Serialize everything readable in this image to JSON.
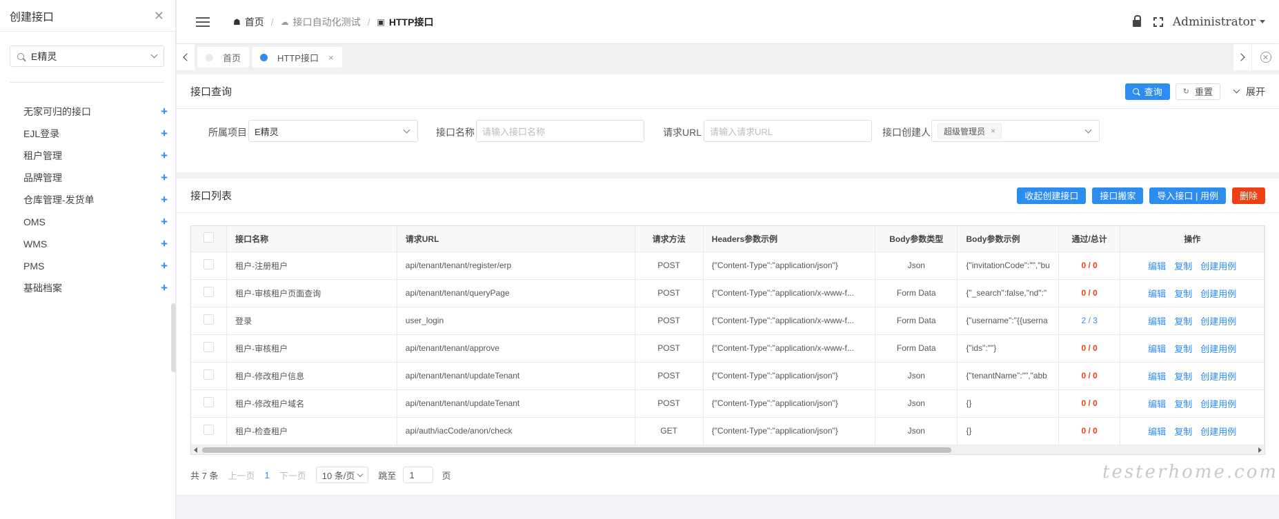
{
  "drawer": {
    "title": "创建接口",
    "close_glyph": "✕",
    "project_value": "E精灵",
    "items": [
      {
        "label": "无家可归的接口"
      },
      {
        "label": "EJL登录"
      },
      {
        "label": "租户管理"
      },
      {
        "label": "品牌管理"
      },
      {
        "label": "仓库管理-发货单"
      },
      {
        "label": "OMS"
      },
      {
        "label": "WMS"
      },
      {
        "label": "PMS"
      },
      {
        "label": "基础档案"
      }
    ],
    "plus_glyph": "+"
  },
  "header": {
    "breadcrumb": [
      "首页",
      "接口自动化测试",
      "HTTP接口"
    ],
    "user": "Administrator"
  },
  "tabs": [
    {
      "label": "首页"
    },
    {
      "label": "HTTP接口",
      "close": "×"
    }
  ],
  "query": {
    "title": "接口查询",
    "search_btn": "查询",
    "reset_btn": "重置",
    "expand": "展开",
    "project_label": "所属项目",
    "project_value": "E精灵",
    "name_label": "接口名称",
    "name_placeholder": "请输入接口名称",
    "url_label": "请求URL",
    "url_placeholder": "请输入请求URL",
    "creator_label": "接口创建人",
    "creator_tag": "超级管理员",
    "tag_close": "×"
  },
  "list": {
    "title": "接口列表",
    "buttons": {
      "collapse_create": "收起创建接口",
      "move": "接口搬家",
      "import": "导入接口 | 用例",
      "delete": "删除"
    },
    "columns": [
      "接口名称",
      "请求URL",
      "请求方法",
      "Headers参数示例",
      "Body参数类型",
      "Body参数示例",
      "通过/总计",
      "操作"
    ],
    "rows": [
      {
        "name": "租户-注册租户",
        "url": "api/tenant/tenant/register/erp",
        "method": "POST",
        "headers": "{\"Content-Type\":\"application/json\"}",
        "body_type": "Json",
        "body": "{\"invitationCode\":\"\",\"bu",
        "pass": "0 / 0"
      },
      {
        "name": "租户-审核租户页面查询",
        "url": "api/tenant/tenant/queryPage",
        "method": "POST",
        "headers": "{\"Content-Type\":\"application/x-www-f...",
        "body_type": "Form Data",
        "body": "{\"_search\":false,\"nd\":\"",
        "pass": "0 / 0"
      },
      {
        "name": "登录",
        "url": "user_login",
        "method": "POST",
        "headers": "{\"Content-Type\":\"application/x-www-f...",
        "body_type": "Form Data",
        "body": "{\"username\":\"{{userna",
        "pass": "2 / 3"
      },
      {
        "name": "租户-审核租户",
        "url": "api/tenant/tenant/approve",
        "method": "POST",
        "headers": "{\"Content-Type\":\"application/x-www-f...",
        "body_type": "Form Data",
        "body": "{\"ids\":\"\"}",
        "pass": "0 / 0"
      },
      {
        "name": "租户-修改租户信息",
        "url": "api/tenant/tenant/updateTenant",
        "method": "POST",
        "headers": "{\"Content-Type\":\"application/json\"}",
        "body_type": "Json",
        "body": "{\"tenantName\":\"\",\"abb",
        "pass": "0 / 0"
      },
      {
        "name": "租户-修改租户域名",
        "url": "api/tenant/tenant/updateTenant",
        "method": "POST",
        "headers": "{\"Content-Type\":\"application/json\"}",
        "body_type": "Json",
        "body": "{}",
        "pass": "0 / 0"
      },
      {
        "name": "租户-检查租户",
        "url": "api/auth/iacCode/anon/check",
        "method": "GET",
        "headers": "{\"Content-Type\":\"application/json\"}",
        "body_type": "Json",
        "body": "{}",
        "pass": "0 / 0"
      }
    ],
    "ops": {
      "edit": "编辑",
      "copy": "复制",
      "create_case": "创建用例"
    }
  },
  "pager": {
    "total": "共 7 条",
    "prev": "上一页",
    "current": "1",
    "next": "下一页",
    "size": "10 条/页",
    "jump": "跳至",
    "jump_value": "1",
    "page": "页"
  },
  "watermark": "testerhome.com",
  "colors": {
    "primary": "#2d8cf0",
    "danger": "#ed4014"
  }
}
